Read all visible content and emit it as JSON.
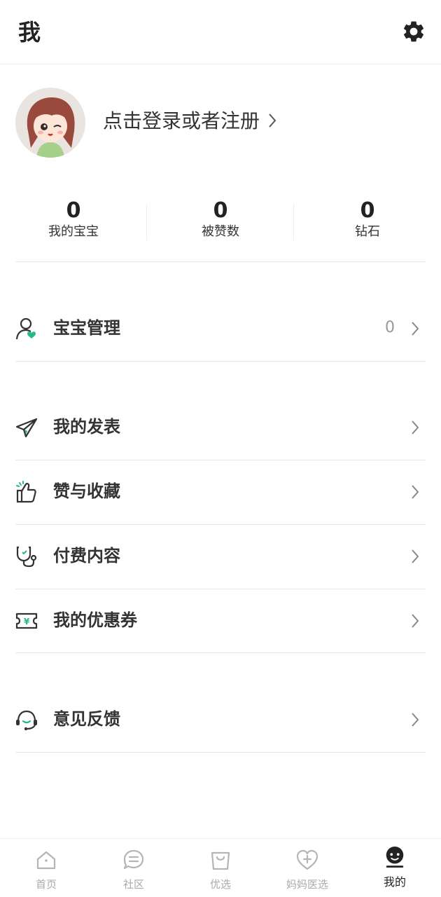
{
  "header": {
    "title": "我"
  },
  "profile": {
    "login_text": "点击登录或者注册"
  },
  "stats": [
    {
      "value": "0",
      "label": "我的宝宝"
    },
    {
      "value": "0",
      "label": "被赞数"
    },
    {
      "value": "0",
      "label": "钻石"
    }
  ],
  "menu": {
    "baby": {
      "label": "宝宝管理",
      "count": "0"
    },
    "posts": {
      "label": "我的发表"
    },
    "likes": {
      "label": "赞与收藏"
    },
    "paid": {
      "label": "付费内容"
    },
    "coupons": {
      "label": "我的优惠券"
    },
    "feedback": {
      "label": "意见反馈"
    }
  },
  "tabs": [
    {
      "label": "首页",
      "icon": "home-icon"
    },
    {
      "label": "社区",
      "icon": "community-icon"
    },
    {
      "label": "优选",
      "icon": "shopping-bag-icon"
    },
    {
      "label": "妈妈医选",
      "icon": "heart-plus-icon"
    },
    {
      "label": "我的",
      "icon": "profile-face-icon",
      "active": true
    }
  ],
  "colors": {
    "accent_green": "#2bb58a",
    "icon_dark": "#333333",
    "inactive": "#aaaaaa"
  }
}
